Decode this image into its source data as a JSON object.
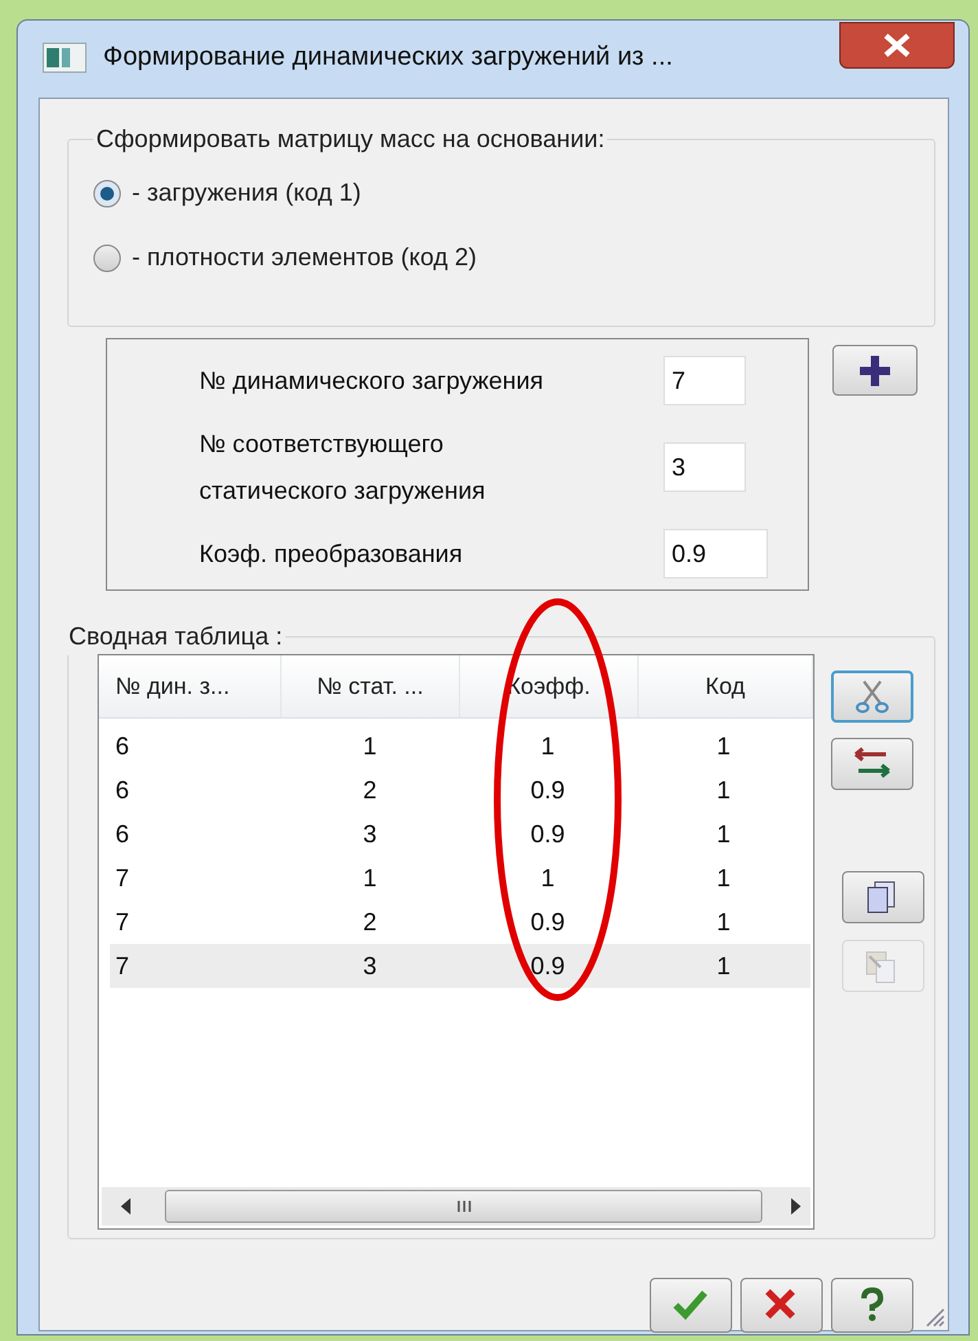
{
  "window": {
    "title": "Формирование динамических загружений из ..."
  },
  "mass_group": {
    "legend": "Сформировать матрицу масс на основании:",
    "radios": [
      {
        "label": "- загружения (код 1)",
        "selected": true
      },
      {
        "label": "- плотности элементов (код 2)",
        "selected": false
      }
    ]
  },
  "params": [
    {
      "label": "№  динамического загружения",
      "value": "7"
    },
    {
      "label": "№ соответствующего статического загружения",
      "value": "3"
    },
    {
      "label": "Коэф. преобразования",
      "value": "0.9"
    }
  ],
  "summary": {
    "legend": "Сводная таблица :",
    "columns": [
      "№ дин. з...",
      "№ стат. ...",
      "Коэфф.",
      "Код"
    ],
    "rows": [
      {
        "cells": [
          "6",
          "1",
          "1",
          "1"
        ],
        "selected": false
      },
      {
        "cells": [
          "6",
          "2",
          "0.9",
          "1"
        ],
        "selected": false
      },
      {
        "cells": [
          "6",
          "3",
          "0.9",
          "1"
        ],
        "selected": false
      },
      {
        "cells": [
          "7",
          "1",
          "1",
          "1"
        ],
        "selected": false
      },
      {
        "cells": [
          "7",
          "2",
          "0.9",
          "1"
        ],
        "selected": false
      },
      {
        "cells": [
          "7",
          "3",
          "0.9",
          "1"
        ],
        "selected": true
      }
    ]
  },
  "side_buttons": [
    {
      "kind": "cut",
      "disabled": false
    },
    {
      "kind": "swap",
      "disabled": false
    },
    {
      "kind": "copy",
      "disabled": false
    },
    {
      "kind": "paste",
      "disabled": true
    }
  ],
  "buttons": [
    {
      "kind": "ok"
    },
    {
      "kind": "cancel"
    },
    {
      "kind": "help"
    }
  ]
}
